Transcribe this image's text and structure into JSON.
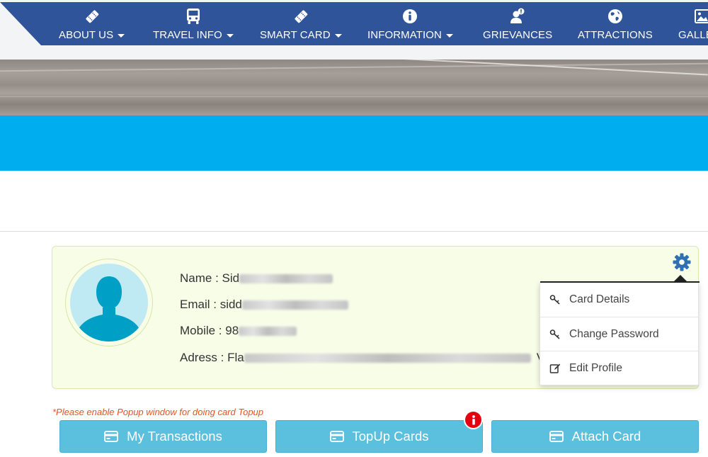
{
  "nav": {
    "items": [
      {
        "label": "ABOUT US",
        "icon": "ticket-icon",
        "dropdown": true
      },
      {
        "label": "TRAVEL INFO",
        "icon": "bus-icon",
        "dropdown": true
      },
      {
        "label": "SMART CARD",
        "icon": "ticket-icon",
        "dropdown": true
      },
      {
        "label": "INFORMATION",
        "icon": "info-circle-icon",
        "dropdown": true
      },
      {
        "label": "GRIEVANCES",
        "icon": "user-alert-icon",
        "dropdown": false
      },
      {
        "label": "ATTRACTIONS",
        "icon": "globe-icon",
        "dropdown": false
      },
      {
        "label": "GALLE",
        "icon": "image-icon",
        "dropdown": false
      }
    ]
  },
  "profile": {
    "name_label": "Name : ",
    "name_value": "Sid",
    "email_label": "Email : ",
    "email_value": "sidd",
    "mobile_label": "Mobile : ",
    "mobile_value": "98",
    "address_label": "Adress : ",
    "address_value": "Fla",
    "address_tail": "V"
  },
  "settings_menu": {
    "items": [
      {
        "label": "Card Details",
        "icon": "key-icon"
      },
      {
        "label": "Change Password",
        "icon": "key-icon"
      },
      {
        "label": "Edit Profile",
        "icon": "edit-icon"
      }
    ]
  },
  "notice": "*Please enable Popup window for doing card Topup",
  "actions": {
    "transactions_label": "My Transactions",
    "topup_label": "TopUp Cards",
    "attach_label": "Attach Card"
  },
  "colors": {
    "nav_bg": "#2f5499",
    "band_blue": "#00adef",
    "card_bg": "#f8fde8",
    "button_bg": "#5bc0de",
    "notice_text": "#e8541c",
    "badge_red": "#e60012"
  }
}
